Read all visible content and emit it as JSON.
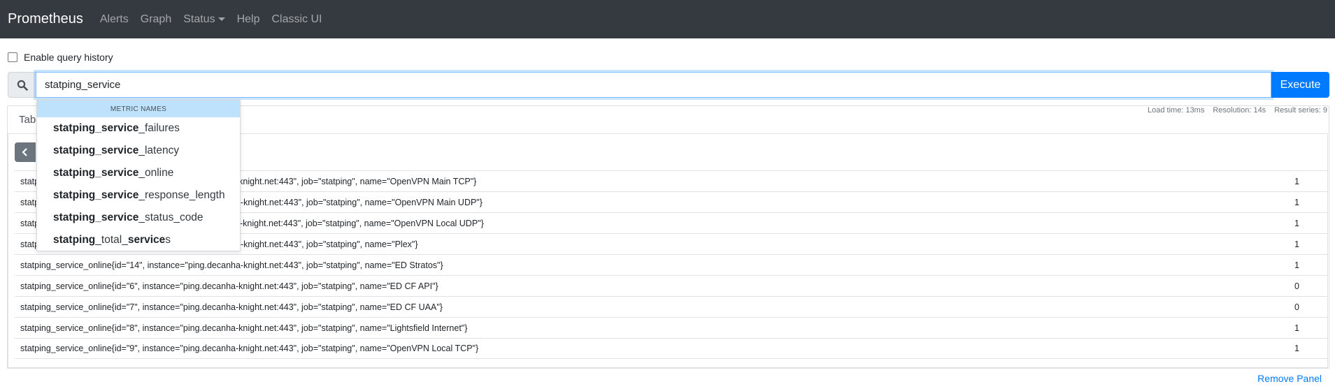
{
  "navbar": {
    "brand": "Prometheus",
    "items": [
      "Alerts",
      "Graph",
      "Status",
      "Help",
      "Classic UI"
    ]
  },
  "history": {
    "label": "Enable query history",
    "checked": false
  },
  "query": {
    "value": "statping_service",
    "execute_label": "Execute"
  },
  "stats": {
    "load_time": "Load time: 13ms",
    "resolution": "Resolution: 14s",
    "result_series": "Result series: 9"
  },
  "tabs": {
    "table_label": "Table"
  },
  "autocomplete": {
    "header": "METRIC NAMES",
    "items": [
      {
        "bold": "statping_service",
        "rest": "_failures"
      },
      {
        "bold": "statping_service",
        "rest": "_latency"
      },
      {
        "bold": "statping_service",
        "rest": "_online"
      },
      {
        "bold": "statping_service",
        "rest": "_response_length"
      },
      {
        "bold": "statping_service",
        "rest": "_status_code"
      },
      {
        "plain": "statping",
        "mid": "_total_",
        "bold": "service",
        "rest": "s"
      }
    ]
  },
  "results": [
    {
      "series": "statping_service_online{id=\"1\", instance=\"ping.decanha-knight.net:443\", job=\"statping\", name=\"OpenVPN Main TCP\"}",
      "value": "1"
    },
    {
      "series": "statping_service_online{id=\"10\", instance=\"ping.decanha-knight.net:443\", job=\"statping\", name=\"OpenVPN Main UDP\"}",
      "value": "1"
    },
    {
      "series": "statping_service_online{id=\"11\", instance=\"ping.decanha-knight.net:443\", job=\"statping\", name=\"OpenVPN Local UDP\"}",
      "value": "1"
    },
    {
      "series": "statping_service_online{id=\"13\", instance=\"ping.decanha-knight.net:443\", job=\"statping\", name=\"Plex\"}",
      "value": "1"
    },
    {
      "series": "statping_service_online{id=\"14\", instance=\"ping.decanha-knight.net:443\", job=\"statping\", name=\"ED Stratos\"}",
      "value": "1"
    },
    {
      "series": "statping_service_online{id=\"6\", instance=\"ping.decanha-knight.net:443\", job=\"statping\", name=\"ED CF API\"}",
      "value": "0"
    },
    {
      "series": "statping_service_online{id=\"7\", instance=\"ping.decanha-knight.net:443\", job=\"statping\", name=\"ED CF UAA\"}",
      "value": "0"
    },
    {
      "series": "statping_service_online{id=\"8\", instance=\"ping.decanha-knight.net:443\", job=\"statping\", name=\"Lightsfield Internet\"}",
      "value": "1"
    },
    {
      "series": "statping_service_online{id=\"9\", instance=\"ping.decanha-knight.net:443\", job=\"statping\", name=\"OpenVPN Local TCP\"}",
      "value": "1"
    }
  ],
  "remove_panel": "Remove Panel",
  "colors": {
    "navbar": "#343a40",
    "primary": "#007bff",
    "ac_header": "#bee2fb"
  }
}
